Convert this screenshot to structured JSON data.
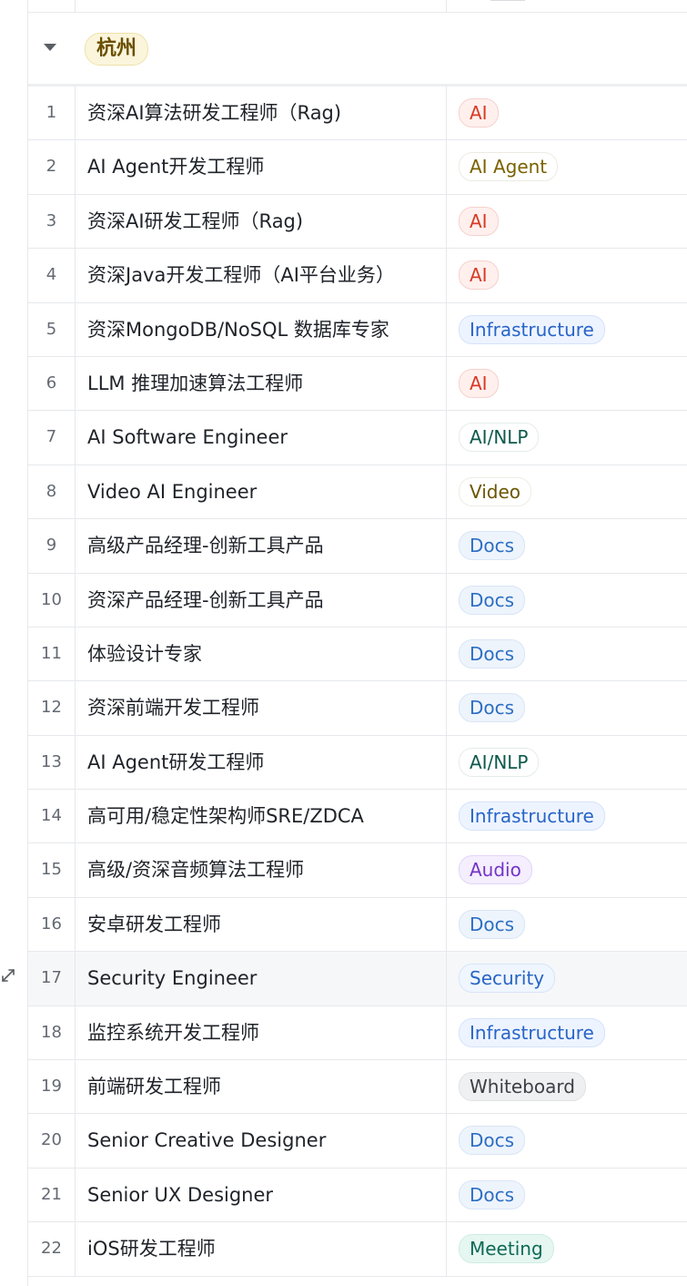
{
  "group": {
    "label": "杭州"
  },
  "rows": [
    {
      "num": "1",
      "title": "资深AI算法研发工程师（Rag)",
      "tag": "AI",
      "tag_class": "t-ai"
    },
    {
      "num": "2",
      "title": "AI Agent开发工程师",
      "tag": "AI Agent",
      "tag_class": "t-aiagent"
    },
    {
      "num": "3",
      "title": "资深AI研发工程师（Rag)",
      "tag": "AI",
      "tag_class": "t-ai"
    },
    {
      "num": "4",
      "title": "资深Java开发工程师（AI平台业务）",
      "tag": "AI",
      "tag_class": "t-ai"
    },
    {
      "num": "5",
      "title": "资深MongoDB/NoSQL 数据库专家",
      "tag": "Infrastructure",
      "tag_class": "t-infra"
    },
    {
      "num": "6",
      "title": "LLM 推理加速算法工程师",
      "tag": "AI",
      "tag_class": "t-ai"
    },
    {
      "num": "7",
      "title": "AI Software Engineer",
      "tag": "AI/NLP",
      "tag_class": "t-ainlp"
    },
    {
      "num": "8",
      "title": "Video AI Engineer",
      "tag": "Video",
      "tag_class": "t-video"
    },
    {
      "num": "9",
      "title": "高级产品经理-创新工具产品",
      "tag": "Docs",
      "tag_class": "t-docs"
    },
    {
      "num": "10",
      "title": "资深产品经理-创新工具产品",
      "tag": "Docs",
      "tag_class": "t-docs"
    },
    {
      "num": "11",
      "title": "体验设计专家",
      "tag": "Docs",
      "tag_class": "t-docs"
    },
    {
      "num": "12",
      "title": "资深前端开发工程师",
      "tag": "Docs",
      "tag_class": "t-docs"
    },
    {
      "num": "13",
      "title": "AI Agent研发工程师",
      "tag": "AI/NLP",
      "tag_class": "t-ainlp"
    },
    {
      "num": "14",
      "title": "高可用/稳定性架构师SRE/ZDCA",
      "tag": "Infrastructure",
      "tag_class": "t-infra"
    },
    {
      "num": "15",
      "title": "高级/资深音频算法工程师",
      "tag": "Audio",
      "tag_class": "t-audio"
    },
    {
      "num": "16",
      "title": "安卓研发工程师",
      "tag": "Docs",
      "tag_class": "t-docs"
    },
    {
      "num": "17",
      "title": "Security Engineer",
      "tag": "Security",
      "tag_class": "t-security"
    },
    {
      "num": "18",
      "title": "监控系统开发工程师",
      "tag": "Infrastructure",
      "tag_class": "t-infra"
    },
    {
      "num": "19",
      "title": "前端研发工程师",
      "tag": "Whiteboard",
      "tag_class": "t-whiteboard"
    },
    {
      "num": "20",
      "title": "Senior Creative Designer",
      "tag": "Docs",
      "tag_class": "t-docs"
    },
    {
      "num": "21",
      "title": "Senior UX Designer",
      "tag": "Docs",
      "tag_class": "t-docs"
    },
    {
      "num": "22",
      "title": "iOS研发工程师",
      "tag": "Meeting",
      "tag_class": "t-meeting"
    }
  ],
  "highlighted_row": "17",
  "icons": {
    "group_toggle": "caret-down-icon",
    "row_expand": "expand-arrows-icon"
  }
}
